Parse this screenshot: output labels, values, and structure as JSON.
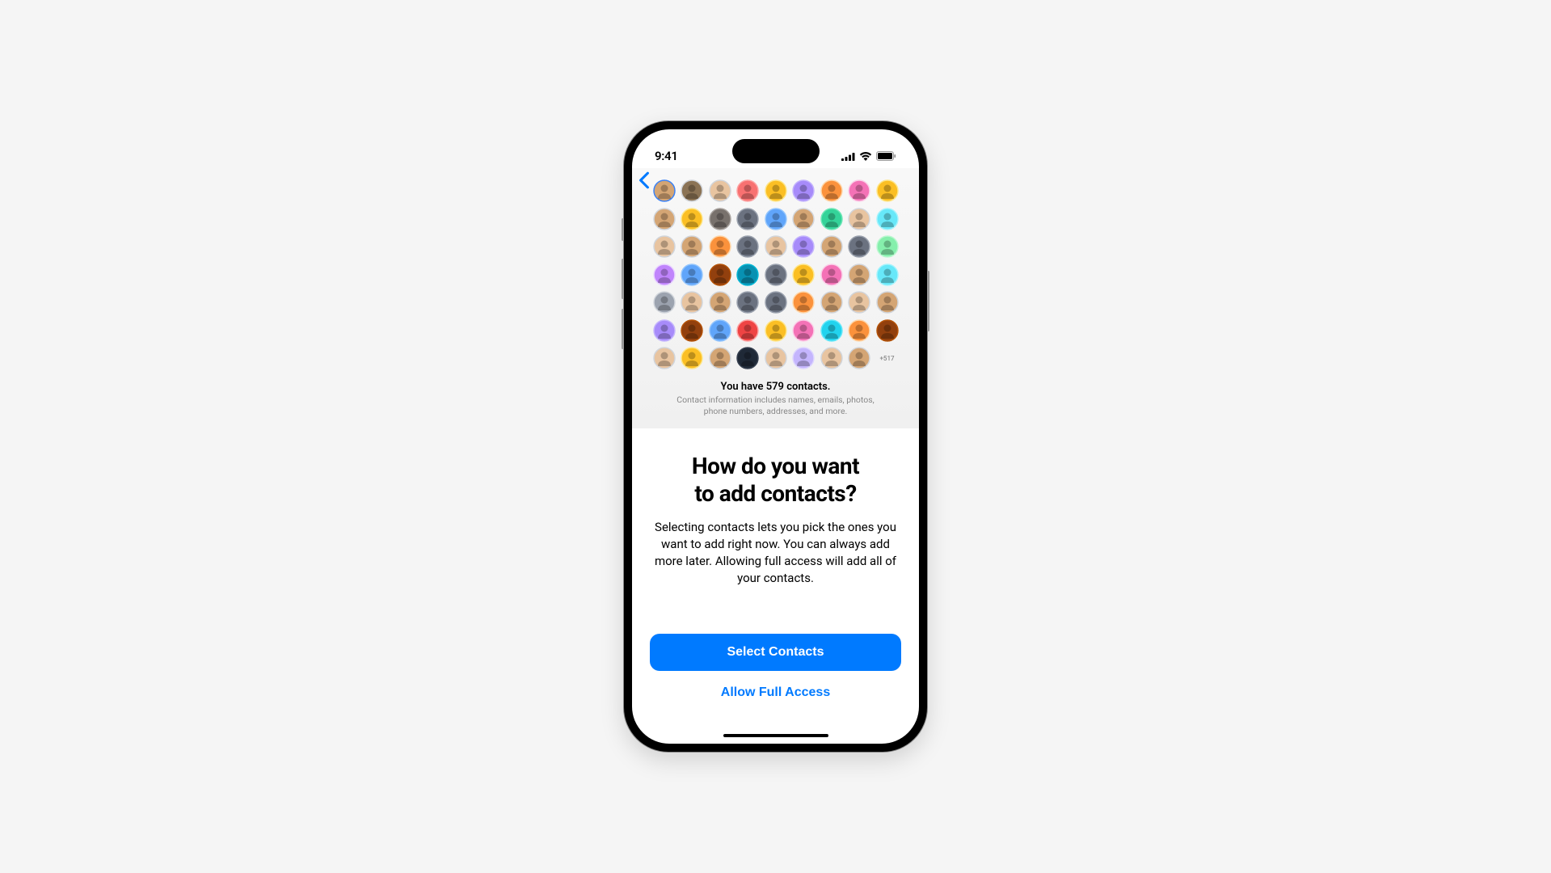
{
  "statusBar": {
    "time": "9:41"
  },
  "avatarGrid": {
    "moreCount": "+517",
    "rows": 7,
    "cols": 9,
    "avatars": [
      {
        "bg": "#d4a574",
        "ring": "#3b82f6"
      },
      {
        "bg": "#8b7355",
        "ring": "#d1d5db"
      },
      {
        "bg": "#e8c4a0",
        "ring": "#d1d5db"
      },
      {
        "bg": "#f87171",
        "ring": "#fca5a5"
      },
      {
        "bg": "#fbbf24",
        "ring": "#fde68a"
      },
      {
        "bg": "#a78bfa",
        "ring": "#c4b5fd"
      },
      {
        "bg": "#fb923c",
        "ring": "#fed7aa"
      },
      {
        "bg": "#f472b6",
        "ring": "#fbcfe8"
      },
      {
        "bg": "#fbbf24",
        "ring": "#fde68a"
      },
      {
        "bg": "#d4a574",
        "ring": "#d1d5db"
      },
      {
        "bg": "#fbbf24",
        "ring": "#fde68a"
      },
      {
        "bg": "#78716c",
        "ring": "#a8a29e"
      },
      {
        "bg": "#6b7280",
        "ring": "#9ca3af"
      },
      {
        "bg": "#60a5fa",
        "ring": "#93c5fd"
      },
      {
        "bg": "#d4a574",
        "ring": "#d1d5db"
      },
      {
        "bg": "#34d399",
        "ring": "#6ee7b7"
      },
      {
        "bg": "#e8c4a0",
        "ring": "#d1d5db"
      },
      {
        "bg": "#67e8f9",
        "ring": "#a5f3fc"
      },
      {
        "bg": "#e8c4a0",
        "ring": "#d1d5db"
      },
      {
        "bg": "#d4a574",
        "ring": "#d1d5db"
      },
      {
        "bg": "#fb923c",
        "ring": "#fed7aa"
      },
      {
        "bg": "#6b7280",
        "ring": "#9ca3af"
      },
      {
        "bg": "#e8c4a0",
        "ring": "#d1d5db"
      },
      {
        "bg": "#a78bfa",
        "ring": "#c4b5fd"
      },
      {
        "bg": "#d4a574",
        "ring": "#d1d5db"
      },
      {
        "bg": "#6b7280",
        "ring": "#9ca3af"
      },
      {
        "bg": "#86efac",
        "ring": "#bbf7d0"
      },
      {
        "bg": "#c084fc",
        "ring": "#e9d5ff"
      },
      {
        "bg": "#60a5fa",
        "ring": "#93c5fd"
      },
      {
        "bg": "#92400e",
        "ring": "#b45309"
      },
      {
        "bg": "#0891b2",
        "ring": "#06b6d4"
      },
      {
        "bg": "#6b7280",
        "ring": "#9ca3af"
      },
      {
        "bg": "#fbbf24",
        "ring": "#fde68a"
      },
      {
        "bg": "#f472b6",
        "ring": "#fbcfe8"
      },
      {
        "bg": "#d4a574",
        "ring": "#d1d5db"
      },
      {
        "bg": "#67e8f9",
        "ring": "#a5f3fc"
      },
      {
        "bg": "#9ca3af",
        "ring": "#d1d5db"
      },
      {
        "bg": "#e8c4a0",
        "ring": "#d1d5db"
      },
      {
        "bg": "#d4a574",
        "ring": "#d1d5db"
      },
      {
        "bg": "#6b7280",
        "ring": "#9ca3af"
      },
      {
        "bg": "#6b7280",
        "ring": "#9ca3af"
      },
      {
        "bg": "#fb923c",
        "ring": "#fed7aa"
      },
      {
        "bg": "#d4a574",
        "ring": "#d1d5db"
      },
      {
        "bg": "#e8c4a0",
        "ring": "#d1d5db"
      },
      {
        "bg": "#d4a574",
        "ring": "#d1d5db"
      },
      {
        "bg": "#a78bfa",
        "ring": "#c4b5fd"
      },
      {
        "bg": "#92400e",
        "ring": "#b45309"
      },
      {
        "bg": "#60a5fa",
        "ring": "#93c5fd"
      },
      {
        "bg": "#ef4444",
        "ring": "#fca5a5"
      },
      {
        "bg": "#fbbf24",
        "ring": "#fde68a"
      },
      {
        "bg": "#f472b6",
        "ring": "#fbcfe8"
      },
      {
        "bg": "#22d3ee",
        "ring": "#67e8f9"
      },
      {
        "bg": "#fb923c",
        "ring": "#fed7aa"
      },
      {
        "bg": "#92400e",
        "ring": "#b45309"
      },
      {
        "bg": "#e8c4a0",
        "ring": "#d1d5db"
      },
      {
        "bg": "#fbbf24",
        "ring": "#fde68a"
      },
      {
        "bg": "#d4a574",
        "ring": "#d1d5db"
      },
      {
        "bg": "#1f2937",
        "ring": "#374151"
      },
      {
        "bg": "#e8c4a0",
        "ring": "#d1d5db"
      },
      {
        "bg": "#c4b5fd",
        "ring": "#ddd6fe"
      },
      {
        "bg": "#e8c4a0",
        "ring": "#d1d5db"
      },
      {
        "bg": "#d4a574",
        "ring": "#d1d5db"
      }
    ]
  },
  "summary": {
    "countText": "You have 579 contacts.",
    "detailLine1": "Contact information includes names, emails, photos,",
    "detailLine2": "phone numbers, addresses, and more."
  },
  "main": {
    "titleLine1": "How do you want",
    "titleLine2": "to add contacts?",
    "description": "Selecting contacts lets you pick the ones you want to add right now. You can always add more later. Allowing full access will add all of your contacts."
  },
  "buttons": {
    "primary": "Select Contacts",
    "secondary": "Allow Full Access"
  }
}
